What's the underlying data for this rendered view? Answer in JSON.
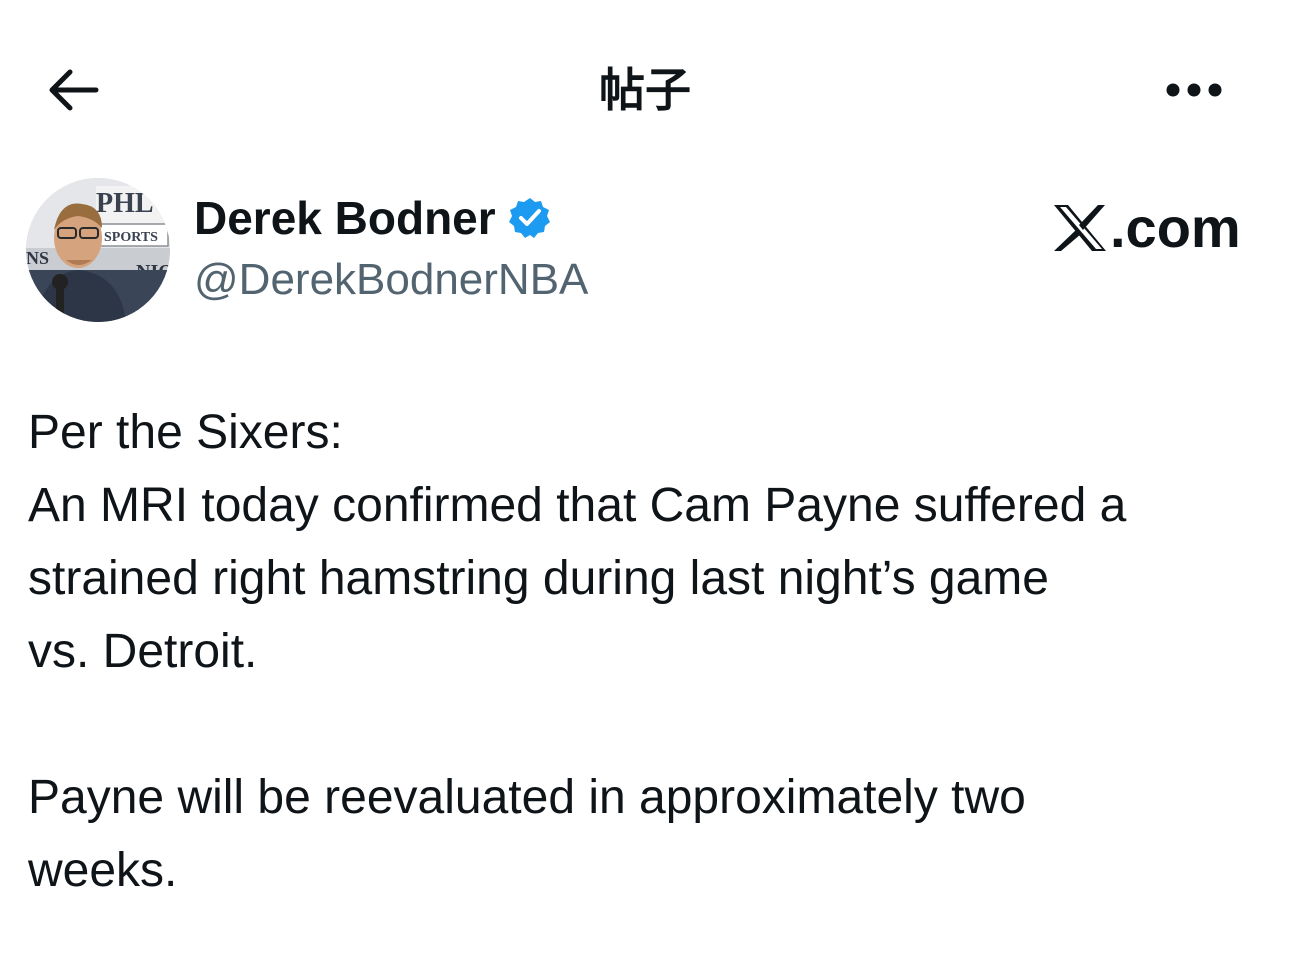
{
  "header": {
    "title": "帖子",
    "back_icon": "arrow-left-icon",
    "more_icon": "more-horizontal-icon"
  },
  "author": {
    "display_name": "Derek Bodner",
    "handle": "@DerekBodnerNBA",
    "verified_icon": "verified-badge-icon",
    "verified_color": "#1d9bf0",
    "avatar_sign_text": [
      "PHL",
      "SPORTS",
      "NS",
      "NIO"
    ]
  },
  "brand": {
    "text": ".com",
    "logo_icon": "x-logo-icon"
  },
  "tweet": {
    "lines": [
      "Per the Sixers:",
      "An MRI today confirmed that Cam Payne suffered a",
      "strained right hamstring during last night’s game",
      "vs. Detroit."
    ],
    "lines2": [
      "Payne will be reevaluated in approximately two",
      "weeks."
    ]
  },
  "colors": {
    "text_primary": "#0f1419",
    "text_secondary": "#536471",
    "accent": "#1d9bf0",
    "background": "#ffffff"
  }
}
